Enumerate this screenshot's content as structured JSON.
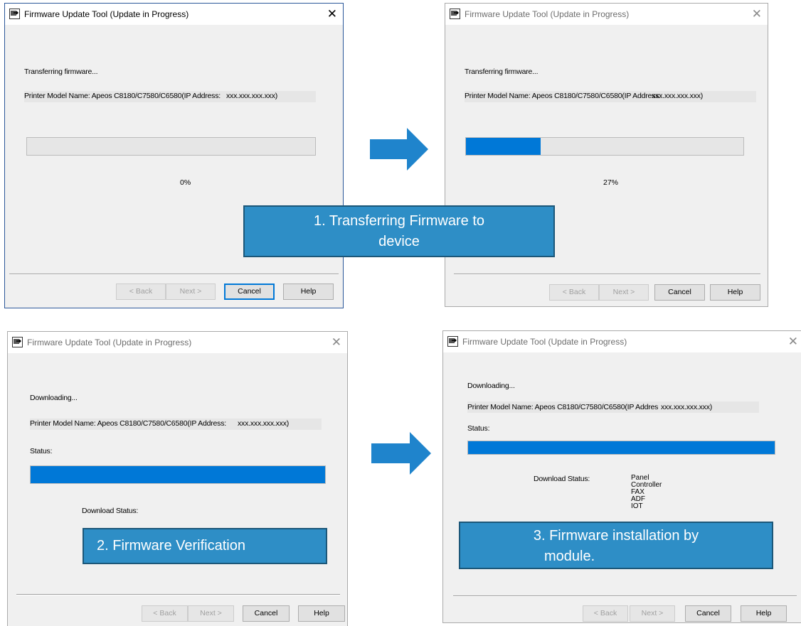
{
  "colors": {
    "accent": "#0078d7",
    "callout_bg": "#2e8ec6",
    "callout_border": "#1c5779",
    "arrow": "#1f84cc"
  },
  "icons": {
    "app": "firmware-tool-icon",
    "close": "close-icon",
    "arrow": "right-arrow-icon"
  },
  "panel1": {
    "title": "Firmware Update Tool (Update in Progress)",
    "close": "✕",
    "status": "Transferring firmware...",
    "model_label": "Printer Model Name: Apeos C8180/C7580/C6580(IP Address:",
    "ip": "xxx.xxx.xxx.xxx)",
    "progress": 0,
    "percent": "0%",
    "buttons": {
      "back": "< Back",
      "next": "Next >",
      "cancel": "Cancel",
      "help": "Help"
    }
  },
  "panel2": {
    "title": "Firmware Update Tool (Update in Progress)",
    "close": "✕",
    "status": "Transferring firmware...",
    "model_label": "Printer Model Name: Apeos C8180/C7580/C6580(IP Address:",
    "ip": "xxx.xxx.xxx.xxx)",
    "progress": 0.27,
    "percent": "27%",
    "buttons": {
      "back": "< Back",
      "next": "Next >",
      "cancel": "Cancel",
      "help": "Help"
    }
  },
  "panel3": {
    "title": "Firmware Update Tool (Update in Progress)",
    "close": "✕",
    "status": "Downloading...",
    "model_label": "Printer Model Name: Apeos C8180/C7580/C6580(IP Address:",
    "ip": "xxx.xxx.xxx.xxx)",
    "status_label": "Status:",
    "progress": 1.0,
    "download_status_label": "Download Status:",
    "buttons": {
      "back": "< Back",
      "next": "Next >",
      "cancel": "Cancel",
      "help": "Help"
    }
  },
  "panel4": {
    "title": "Firmware Update Tool (Update in Progress)",
    "close": "✕",
    "status": "Downloading...",
    "model_label": "Printer Model Name: Apeos C8180/C7580/C6580(IP Addres",
    "ip": "xxx.xxx.xxx.xxx)",
    "status_label": "Status:",
    "progress": 1.0,
    "download_status_label": "Download Status:",
    "modules": [
      "Panel",
      "Controller",
      "FAX",
      "ADF",
      "IOT"
    ],
    "buttons": {
      "back": "< Back",
      "next": "Next >",
      "cancel": "Cancel",
      "help": "Help"
    }
  },
  "callouts": {
    "step1_line1": "1.  Transferring Firmware to",
    "step1_line2": "device",
    "step2": "2.  Firmware Verification",
    "step3_line1": "3.  Firmware installation by",
    "step3_line2": "module."
  }
}
